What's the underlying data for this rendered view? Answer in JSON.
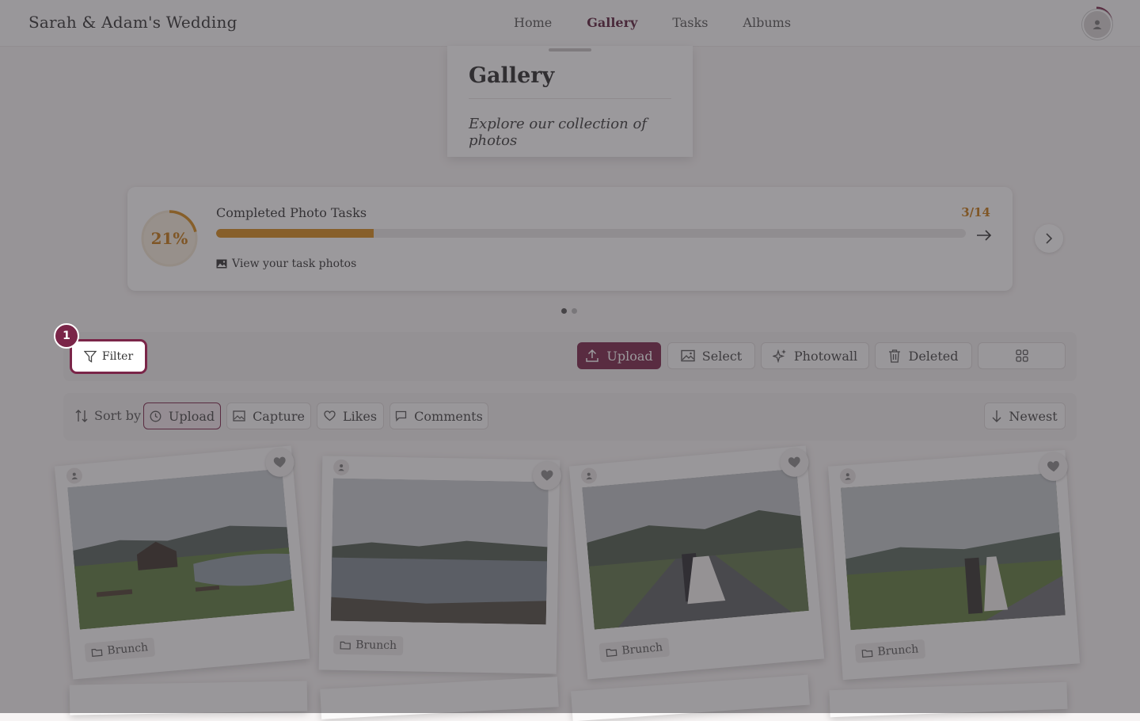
{
  "header": {
    "brand": "Sarah & Adam's Wedding",
    "nav": [
      {
        "label": "Home",
        "active": false
      },
      {
        "label": "Gallery",
        "active": true
      },
      {
        "label": "Tasks",
        "active": false
      },
      {
        "label": "Albums",
        "active": false
      }
    ]
  },
  "gallery_card": {
    "title": "Gallery",
    "subtitle": "Explore our collection of photos"
  },
  "tasks": {
    "percent_label": "21%",
    "progress": 0.21,
    "label": "Completed Photo Tasks",
    "count": "3/14",
    "link": "View your task photos"
  },
  "toolbar": {
    "filter": "Filter",
    "step_badge": "1",
    "upload": "Upload",
    "select": "Select",
    "photowall": "Photowall",
    "deleted": "Deleted"
  },
  "sort": {
    "label": "Sort by",
    "upload": "Upload",
    "capture": "Capture",
    "likes": "Likes",
    "comments": "Comments",
    "order": "Newest"
  },
  "photos": [
    {
      "tag": "Brunch",
      "scene": "cabin-lake"
    },
    {
      "tag": "Brunch",
      "scene": "lake"
    },
    {
      "tag": "Brunch",
      "scene": "couple-road-kiss"
    },
    {
      "tag": "Brunch",
      "scene": "couple-walk"
    }
  ],
  "colors": {
    "accent": "#7a2548",
    "progress": "#d68a1a",
    "overlay": "rgba(55,52,58,0.5)"
  }
}
